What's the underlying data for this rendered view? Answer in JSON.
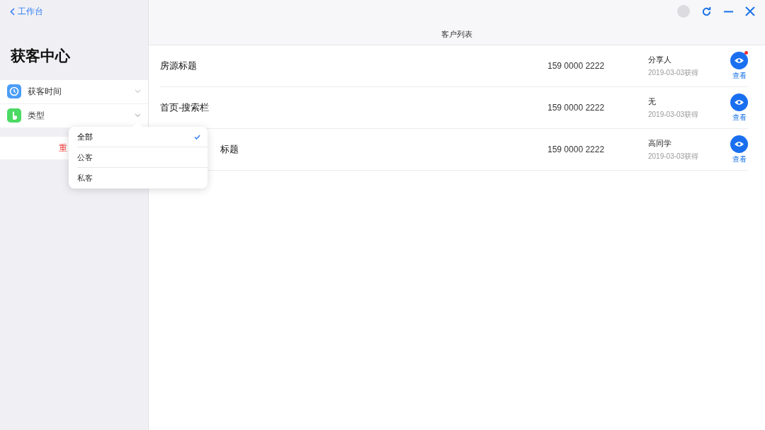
{
  "sidebar": {
    "back": "工作台",
    "title": "获客中心",
    "filters": [
      {
        "label": "获客时间",
        "expanded": false
      },
      {
        "label": "类型",
        "expanded": true
      }
    ],
    "reset": "重"
  },
  "dropdown": {
    "options": [
      {
        "label": "全部",
        "selected": true
      },
      {
        "label": "公客",
        "selected": false
      },
      {
        "label": "私客",
        "selected": false
      }
    ]
  },
  "main": {
    "title": "客户列表",
    "rows": [
      {
        "title": "房源标题",
        "covered": false,
        "phone": "159 0000 2222",
        "person": "分享人",
        "date": "2019-03-03获得",
        "action": "查看",
        "unread": true
      },
      {
        "title": "首页-搜索栏",
        "covered": false,
        "phone": "159 0000 2222",
        "person": "无",
        "date": "2019-03-03获得",
        "action": "查看",
        "unread": false
      },
      {
        "title": "标题",
        "covered": true,
        "phone": "159 0000 2222",
        "person": "高同学",
        "date": "2019-03-03获得",
        "action": "查看",
        "unread": false
      }
    ]
  }
}
